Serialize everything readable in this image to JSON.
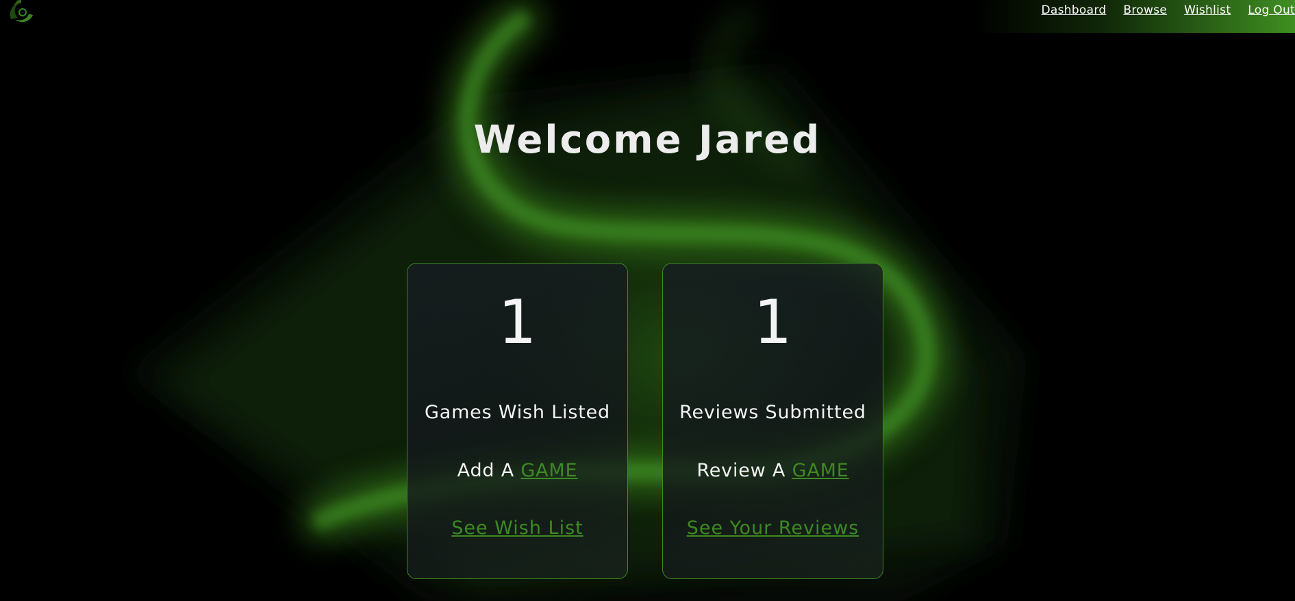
{
  "colors": {
    "accent": "#3d8a22",
    "card_border": "#3e8a1e",
    "background": "#000000",
    "text": "#f2f2f2"
  },
  "nav": {
    "links": [
      "Dashboard",
      "Browse",
      "Wishlist",
      "Log Out"
    ]
  },
  "heading": "Welcome Jared",
  "cards": [
    {
      "count": "1",
      "label": "Games Wish Listed",
      "action_prefix": "Add A",
      "action_link": "GAME",
      "see_link": "See Wish List"
    },
    {
      "count": "1",
      "label": "Reviews Submitted",
      "action_prefix": "Review A",
      "action_link": "GAME",
      "see_link": "See Your Reviews"
    }
  ]
}
